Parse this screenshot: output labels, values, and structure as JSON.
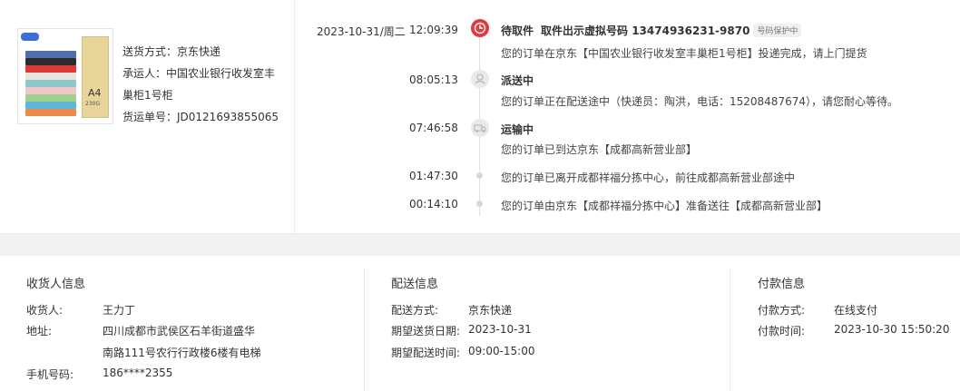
{
  "product": {
    "pack_label": "A4",
    "pack_sub": "230G"
  },
  "shipping": {
    "method": "送货方式：京东快递",
    "carrier_line1": "承运人：中国农业银行收发室丰",
    "carrier_line2": "巢柜1号柜",
    "tracking": "货运单号：JD0121693855065"
  },
  "timeline": {
    "date": "2023-10-31/周二",
    "events": [
      {
        "time": "12:09:39",
        "title": "待取件",
        "code": "取件出示虚拟号码 13474936231-9870",
        "badge": "号码保护中",
        "desc": "您的订单在京东【中国农业银行收发室丰巢柜1号柜】投递完成，请上门提货"
      },
      {
        "time": "08:05:13",
        "title": "派送中",
        "desc": "您的订单正在配送途中（快递员：陶洪，电话：15208487674），请您耐心等待。"
      },
      {
        "time": "07:46:58",
        "title": "运输中",
        "desc": "您的订单已到达京东【成都高新营业部】"
      },
      {
        "time": "01:47:30",
        "desc": "您的订单已离开成都祥福分拣中心，前往成都高新营业部途中"
      },
      {
        "time": "00:14:10",
        "desc": "您的订单由京东【成都祥福分拣中心】准备送往【成都高新营业部】"
      }
    ]
  },
  "receiver": {
    "title": "收货人信息",
    "name_label": "收货人:",
    "name": "王力丁",
    "address_label": "地址:",
    "address_line1": "四川成都市武侯区石羊街道盛华",
    "address_line2": "南路111号农行行政楼6楼有电梯",
    "phone_label": "手机号码:",
    "phone": "186****2355"
  },
  "delivery": {
    "title": "配送信息",
    "method_label": "配送方式:",
    "method": "京东快递",
    "date_label": "期望送货日期:",
    "date": "2023-10-31",
    "time_label": "期望配送时间:",
    "time": "09:00-15:00"
  },
  "payment": {
    "title": "付款信息",
    "method_label": "付款方式:",
    "method": "在线支付",
    "time_label": "付款时间:",
    "time": "2023-10-30 15:50:20"
  },
  "colors": {
    "accent": "#e4393c",
    "node_gray": "#e9e9e9"
  },
  "icons": {
    "active_node": "clock-icon",
    "dispatch_node": "courier-icon",
    "transit_node": "truck-icon"
  }
}
